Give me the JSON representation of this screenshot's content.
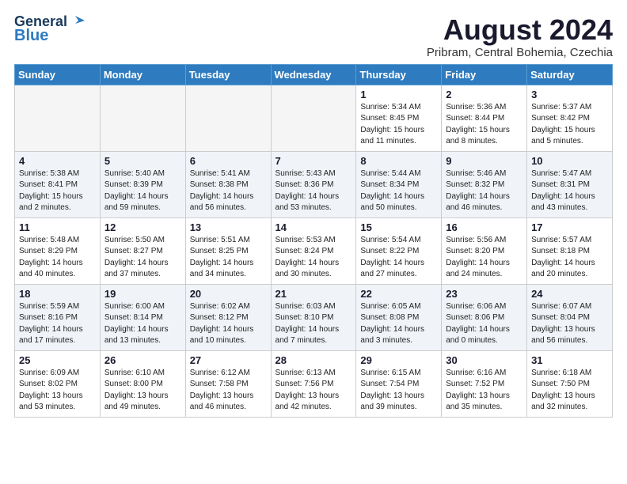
{
  "header": {
    "logo_general": "General",
    "logo_blue": "Blue",
    "month_title": "August 2024",
    "location": "Pribram, Central Bohemia, Czechia"
  },
  "days_of_week": [
    "Sunday",
    "Monday",
    "Tuesday",
    "Wednesday",
    "Thursday",
    "Friday",
    "Saturday"
  ],
  "weeks": [
    [
      {
        "day": "",
        "info": ""
      },
      {
        "day": "",
        "info": ""
      },
      {
        "day": "",
        "info": ""
      },
      {
        "day": "",
        "info": ""
      },
      {
        "day": "1",
        "info": "Sunrise: 5:34 AM\nSunset: 8:45 PM\nDaylight: 15 hours\nand 11 minutes."
      },
      {
        "day": "2",
        "info": "Sunrise: 5:36 AM\nSunset: 8:44 PM\nDaylight: 15 hours\nand 8 minutes."
      },
      {
        "day": "3",
        "info": "Sunrise: 5:37 AM\nSunset: 8:42 PM\nDaylight: 15 hours\nand 5 minutes."
      }
    ],
    [
      {
        "day": "4",
        "info": "Sunrise: 5:38 AM\nSunset: 8:41 PM\nDaylight: 15 hours\nand 2 minutes."
      },
      {
        "day": "5",
        "info": "Sunrise: 5:40 AM\nSunset: 8:39 PM\nDaylight: 14 hours\nand 59 minutes."
      },
      {
        "day": "6",
        "info": "Sunrise: 5:41 AM\nSunset: 8:38 PM\nDaylight: 14 hours\nand 56 minutes."
      },
      {
        "day": "7",
        "info": "Sunrise: 5:43 AM\nSunset: 8:36 PM\nDaylight: 14 hours\nand 53 minutes."
      },
      {
        "day": "8",
        "info": "Sunrise: 5:44 AM\nSunset: 8:34 PM\nDaylight: 14 hours\nand 50 minutes."
      },
      {
        "day": "9",
        "info": "Sunrise: 5:46 AM\nSunset: 8:32 PM\nDaylight: 14 hours\nand 46 minutes."
      },
      {
        "day": "10",
        "info": "Sunrise: 5:47 AM\nSunset: 8:31 PM\nDaylight: 14 hours\nand 43 minutes."
      }
    ],
    [
      {
        "day": "11",
        "info": "Sunrise: 5:48 AM\nSunset: 8:29 PM\nDaylight: 14 hours\nand 40 minutes."
      },
      {
        "day": "12",
        "info": "Sunrise: 5:50 AM\nSunset: 8:27 PM\nDaylight: 14 hours\nand 37 minutes."
      },
      {
        "day": "13",
        "info": "Sunrise: 5:51 AM\nSunset: 8:25 PM\nDaylight: 14 hours\nand 34 minutes."
      },
      {
        "day": "14",
        "info": "Sunrise: 5:53 AM\nSunset: 8:24 PM\nDaylight: 14 hours\nand 30 minutes."
      },
      {
        "day": "15",
        "info": "Sunrise: 5:54 AM\nSunset: 8:22 PM\nDaylight: 14 hours\nand 27 minutes."
      },
      {
        "day": "16",
        "info": "Sunrise: 5:56 AM\nSunset: 8:20 PM\nDaylight: 14 hours\nand 24 minutes."
      },
      {
        "day": "17",
        "info": "Sunrise: 5:57 AM\nSunset: 8:18 PM\nDaylight: 14 hours\nand 20 minutes."
      }
    ],
    [
      {
        "day": "18",
        "info": "Sunrise: 5:59 AM\nSunset: 8:16 PM\nDaylight: 14 hours\nand 17 minutes."
      },
      {
        "day": "19",
        "info": "Sunrise: 6:00 AM\nSunset: 8:14 PM\nDaylight: 14 hours\nand 13 minutes."
      },
      {
        "day": "20",
        "info": "Sunrise: 6:02 AM\nSunset: 8:12 PM\nDaylight: 14 hours\nand 10 minutes."
      },
      {
        "day": "21",
        "info": "Sunrise: 6:03 AM\nSunset: 8:10 PM\nDaylight: 14 hours\nand 7 minutes."
      },
      {
        "day": "22",
        "info": "Sunrise: 6:05 AM\nSunset: 8:08 PM\nDaylight: 14 hours\nand 3 minutes."
      },
      {
        "day": "23",
        "info": "Sunrise: 6:06 AM\nSunset: 8:06 PM\nDaylight: 14 hours\nand 0 minutes."
      },
      {
        "day": "24",
        "info": "Sunrise: 6:07 AM\nSunset: 8:04 PM\nDaylight: 13 hours\nand 56 minutes."
      }
    ],
    [
      {
        "day": "25",
        "info": "Sunrise: 6:09 AM\nSunset: 8:02 PM\nDaylight: 13 hours\nand 53 minutes."
      },
      {
        "day": "26",
        "info": "Sunrise: 6:10 AM\nSunset: 8:00 PM\nDaylight: 13 hours\nand 49 minutes."
      },
      {
        "day": "27",
        "info": "Sunrise: 6:12 AM\nSunset: 7:58 PM\nDaylight: 13 hours\nand 46 minutes."
      },
      {
        "day": "28",
        "info": "Sunrise: 6:13 AM\nSunset: 7:56 PM\nDaylight: 13 hours\nand 42 minutes."
      },
      {
        "day": "29",
        "info": "Sunrise: 6:15 AM\nSunset: 7:54 PM\nDaylight: 13 hours\nand 39 minutes."
      },
      {
        "day": "30",
        "info": "Sunrise: 6:16 AM\nSunset: 7:52 PM\nDaylight: 13 hours\nand 35 minutes."
      },
      {
        "day": "31",
        "info": "Sunrise: 6:18 AM\nSunset: 7:50 PM\nDaylight: 13 hours\nand 32 minutes."
      }
    ]
  ]
}
